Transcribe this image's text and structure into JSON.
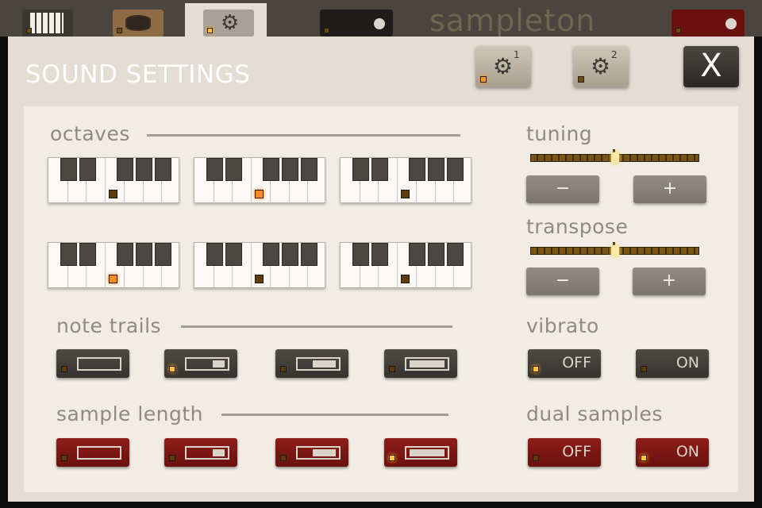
{
  "topbar": {
    "tabs": [
      {
        "id": "keys",
        "icon": "piano-keys-icon",
        "led": false
      },
      {
        "id": "drum",
        "icon": "drum-icon",
        "led": false
      },
      {
        "id": "settings",
        "icon": "gear-icon",
        "led": true,
        "active": true
      },
      {
        "id": "record",
        "icon": "record-icon",
        "led": false
      },
      {
        "id": "red",
        "icon": "record-icon",
        "led": false
      }
    ],
    "brand": "sampleton"
  },
  "panel": {
    "title": "SOUND SETTINGS",
    "header_buttons": [
      {
        "id": "settings-1",
        "icon": "gear-icon",
        "superscript": "1",
        "led": true
      },
      {
        "id": "settings-2",
        "icon": "gear-icon",
        "superscript": "2",
        "led": false
      }
    ],
    "close_label": "X"
  },
  "sections": {
    "octaves": {
      "label": "octaves",
      "selected_key_positions": [
        {
          "keyboard": 1,
          "key_index": 3,
          "on": false
        },
        {
          "keyboard": 2,
          "key_index": 3,
          "on": true
        },
        {
          "keyboard": 3,
          "key_index": 3,
          "on": false
        },
        {
          "keyboard": 4,
          "key_index": 3,
          "on": true
        },
        {
          "keyboard": 5,
          "key_index": 3,
          "on": false
        },
        {
          "keyboard": 6,
          "key_index": 3,
          "on": false
        }
      ]
    },
    "tuning": {
      "label": "tuning",
      "value": 0.5,
      "minus": "−",
      "plus": "+"
    },
    "transpose": {
      "label": "transpose",
      "value": 0.5,
      "minus": "−",
      "plus": "+"
    },
    "note_trails": {
      "label": "note trails",
      "options": [
        {
          "level": 0.0,
          "selected": false
        },
        {
          "level": 0.33,
          "selected": true
        },
        {
          "level": 0.66,
          "selected": false
        },
        {
          "level": 1.0,
          "selected": false
        }
      ]
    },
    "vibrato": {
      "label": "vibrato",
      "options": [
        {
          "text": "OFF",
          "selected": true
        },
        {
          "text": "ON",
          "selected": false
        }
      ]
    },
    "sample_length": {
      "label": "sample length",
      "options": [
        {
          "level": 0.0,
          "selected": false
        },
        {
          "level": 0.33,
          "selected": false
        },
        {
          "level": 0.66,
          "selected": false
        },
        {
          "level": 1.0,
          "selected": true
        }
      ]
    },
    "dual_samples": {
      "label": "dual samples",
      "options": [
        {
          "text": "OFF",
          "selected": false
        },
        {
          "text": "ON",
          "selected": true
        }
      ]
    }
  },
  "colors": {
    "panel": "#e3ddd3",
    "inner": "#f1ede5",
    "label": "#8f8a83",
    "led_on": "#ffbf3a",
    "red_button": "#8e1d18",
    "dark_button": "#4f4a45"
  }
}
